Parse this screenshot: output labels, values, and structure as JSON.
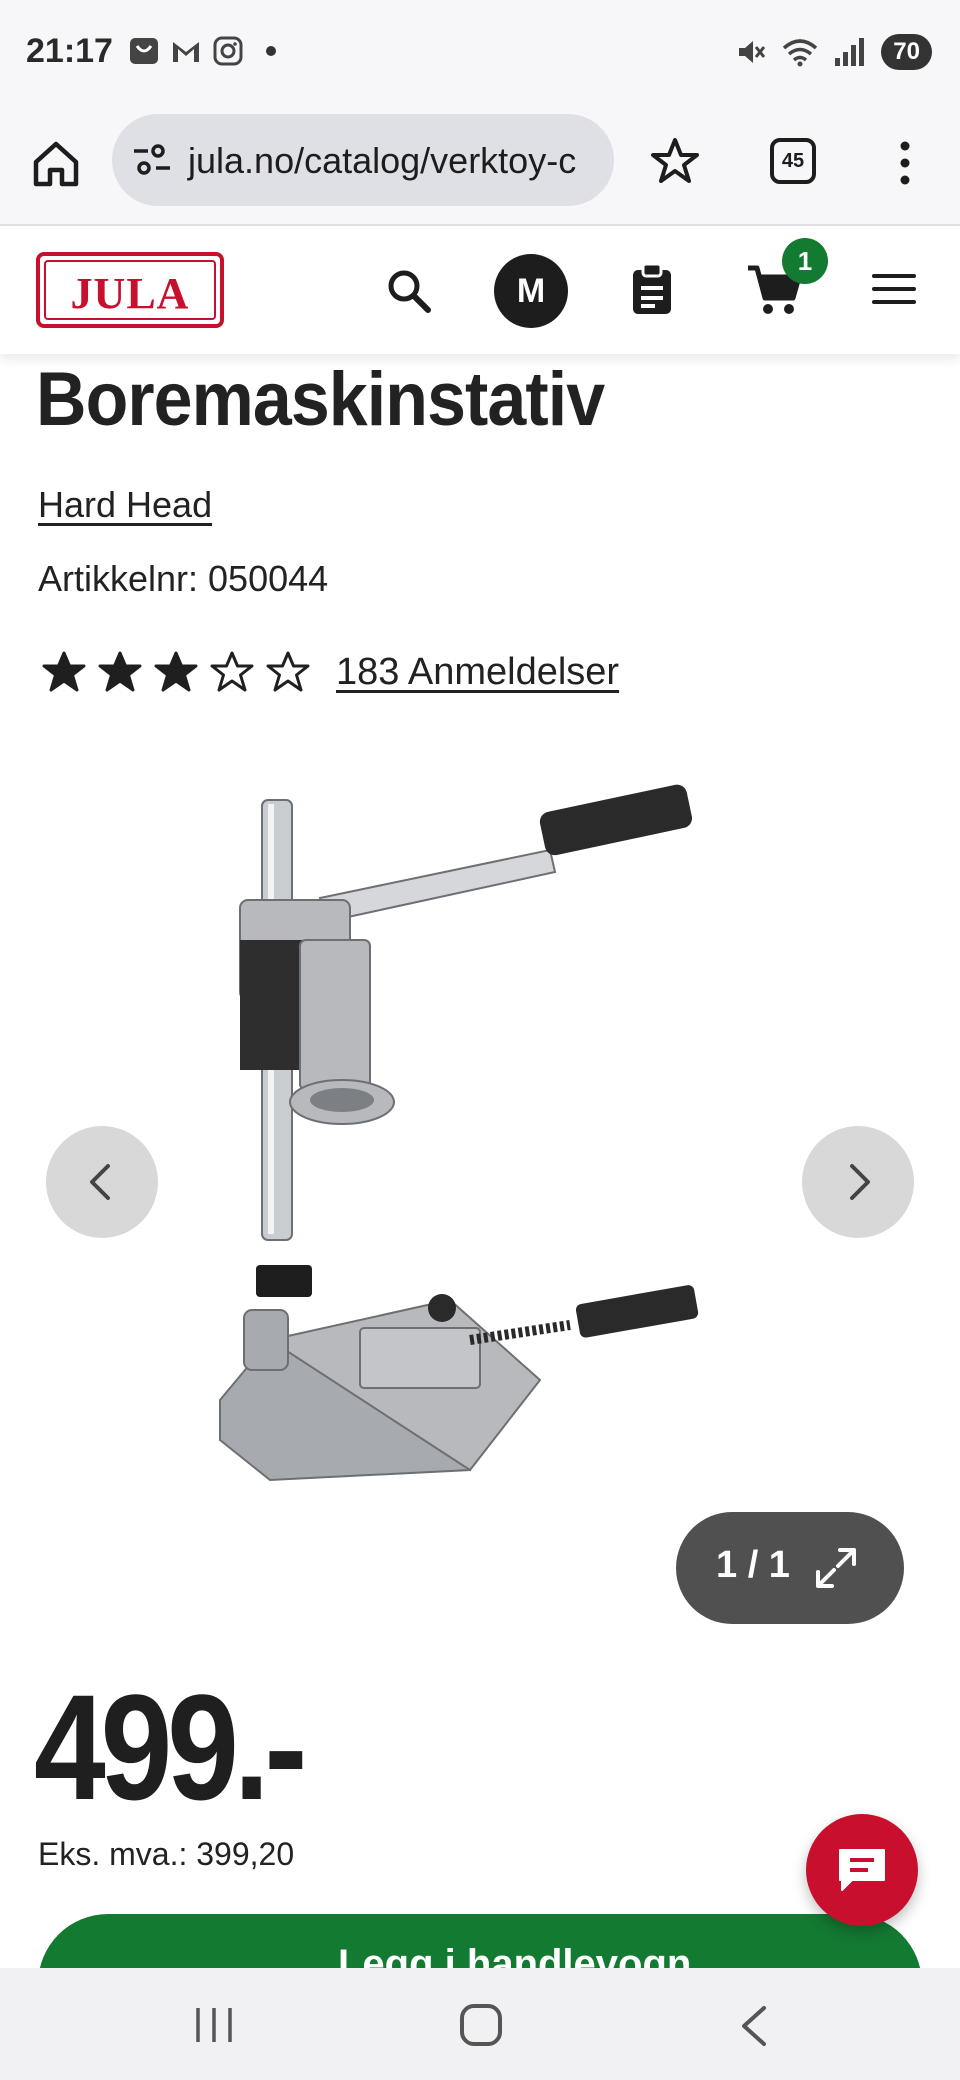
{
  "status_bar": {
    "time": "21:17",
    "left_icons": [
      "shopping-bag-icon",
      "gmail-icon",
      "instagram-icon"
    ],
    "right_icons": [
      "mute-icon",
      "wifi-icon",
      "signal-icon"
    ],
    "battery": "70"
  },
  "browser": {
    "url": "jula.no/catalog/verktoy-c",
    "tab_count": "45"
  },
  "header": {
    "logo_text": "JULA",
    "avatar_initial": "M",
    "cart_count": "1",
    "brand_color": "#c8102e",
    "accent_green": "#137a32"
  },
  "product": {
    "title": "Boremaskinstativ",
    "brand": "Hard Head",
    "article_number": "Artikkelnr: 050044",
    "rating": 3,
    "rating_max": 5,
    "reviews": "183 Anmeldelser",
    "image_counter": "1 / 1",
    "price": "499.-",
    "ex_vat": "Eks. mva.: 399,20",
    "buy_button_label": "Legg i handlevogn"
  }
}
